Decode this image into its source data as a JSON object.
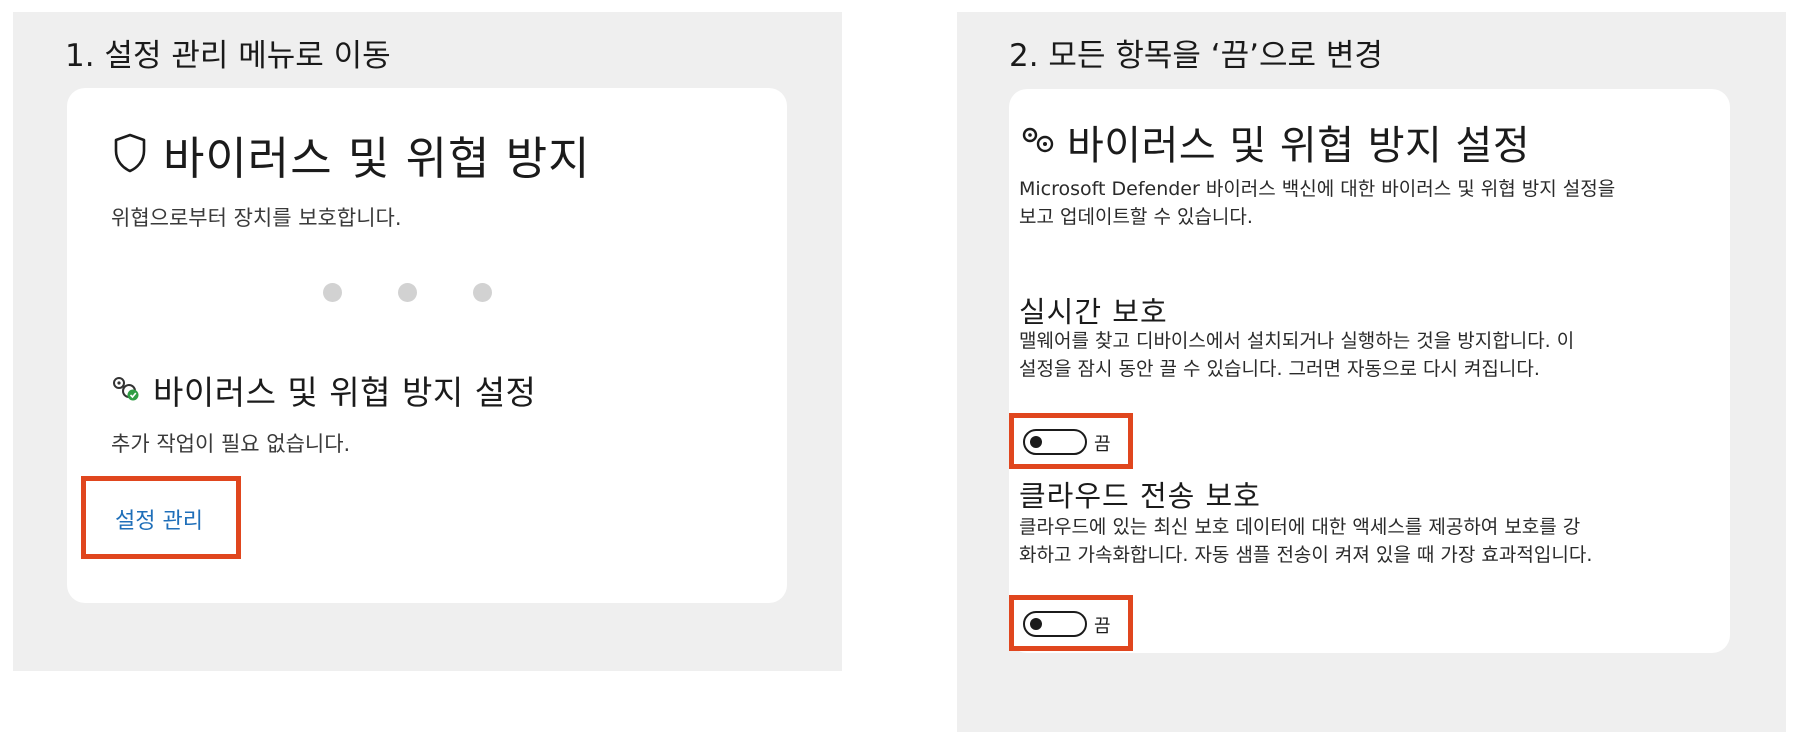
{
  "step1": {
    "title": "1. 설정 관리 메뉴로 이동",
    "card": {
      "heading": "바이러스 및 위협 방지",
      "subtitle": "위협으로부터 장치를 보호합니다.",
      "settings_heading": "바이러스 및 위협 방지 설정",
      "settings_status": "추가 작업이 필요 없습니다.",
      "manage_link": "설정 관리"
    }
  },
  "step2": {
    "title": "2. 모든 항목을 ‘끔’으로 변경",
    "card": {
      "heading": "바이러스 및 위협 방지 설정",
      "description": [
        "Microsoft Defender 바이러스 백신에 대한 바이러스 및 위협 방지 설정을",
        "보고 업데이트할 수 있습니다."
      ],
      "realtime": {
        "heading": "실시간 보호",
        "description": [
          "맬웨어를 찾고 디바이스에서 설치되거나 실행하는 것을 방지합니다. 이",
          "설정을 잠시 동안 끌 수 있습니다. 그러면 자동으로 다시 켜집니다."
        ],
        "toggle_label": "끔",
        "toggle_state": "off"
      },
      "cloud": {
        "heading": "클라우드 전송 보호",
        "description": [
          "클라우드에 있는 최신 보호 데이터에 대한 액세스를 제공하여 보호를 강",
          "화하고 가속화합니다. 자동 샘플 전송이 켜져 있을 때 가장 효과적입니다."
        ],
        "toggle_label": "끔",
        "toggle_state": "off"
      }
    }
  },
  "icons": {
    "shield": "shield-icon",
    "settings": "gears-icon",
    "settings_ok": "gears-checkmark-icon"
  },
  "colors": {
    "highlight": "#e0461e",
    "link": "#1f6fb9",
    "panel_bg": "#efefef",
    "card_bg": "#ffffff"
  }
}
